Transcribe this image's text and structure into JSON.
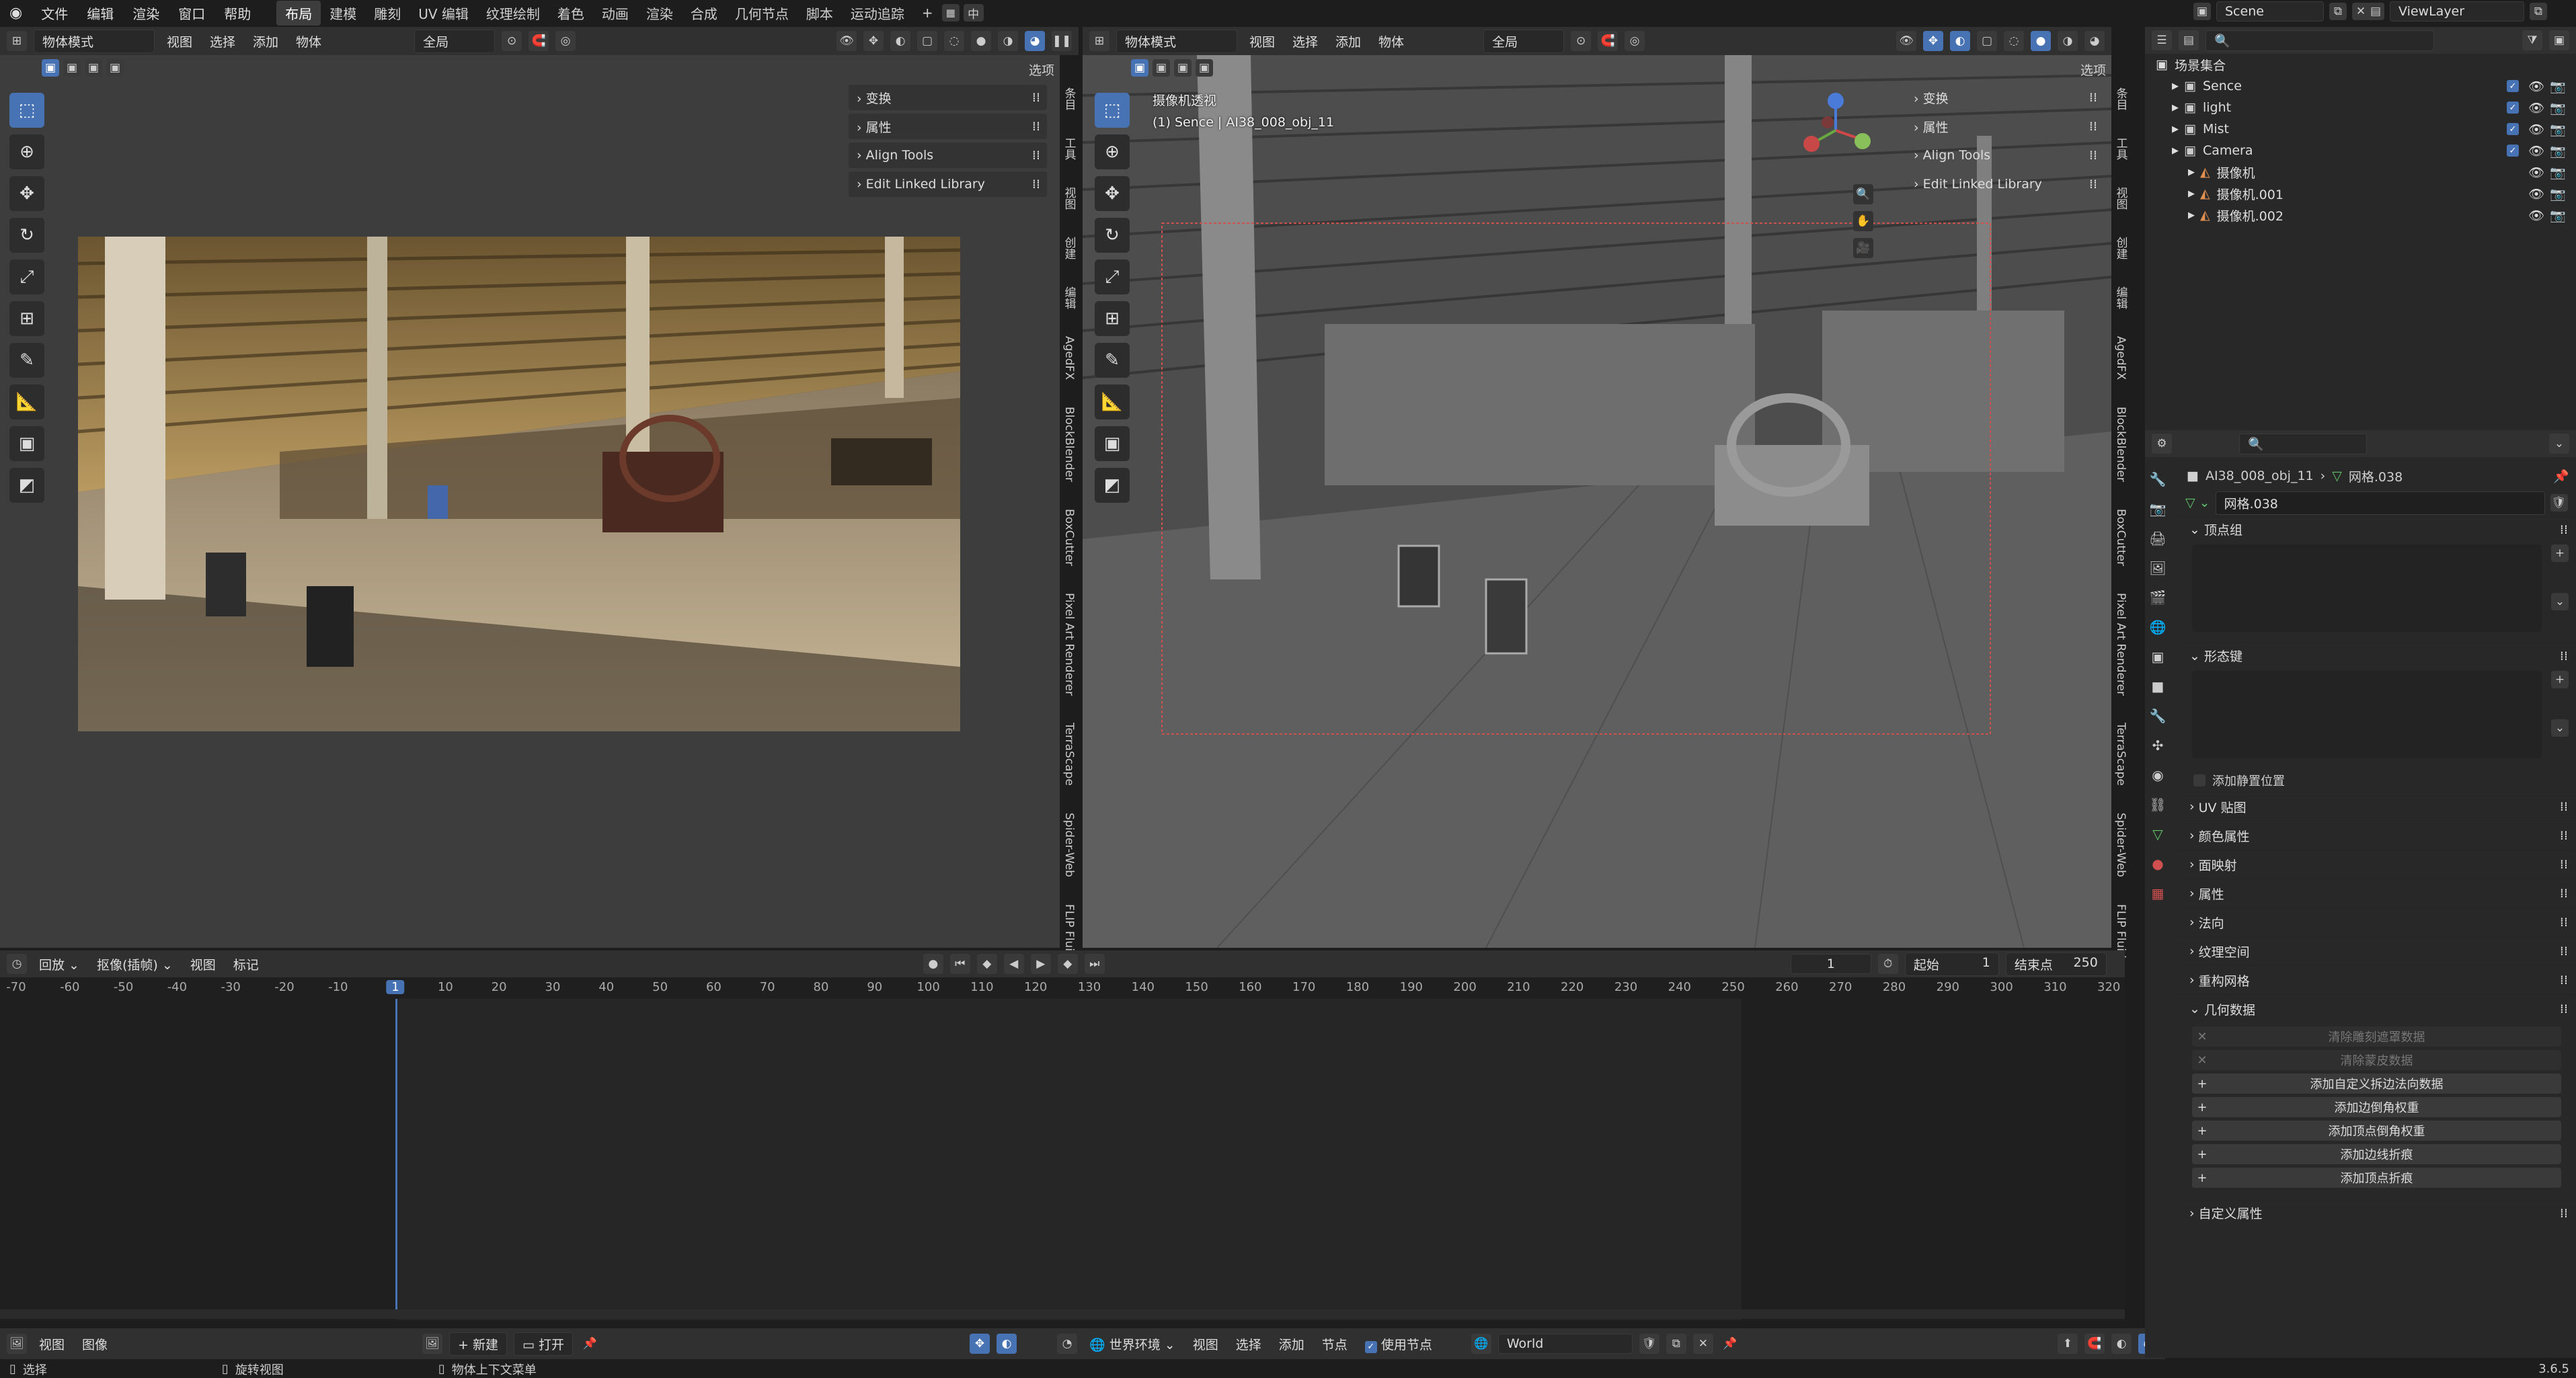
{
  "topbar": {
    "menus": [
      "文件",
      "编辑",
      "渲染",
      "窗口",
      "帮助"
    ],
    "workspace_tabs": [
      "布局",
      "建模",
      "雕刻",
      "UV 编辑",
      "纹理绘制",
      "着色",
      "动画",
      "渲染",
      "合成",
      "几何节点",
      "脚本",
      "运动追踪"
    ],
    "active_tab": "布局",
    "ime_label": "中",
    "scene_name": "Scene",
    "view_layer_name": "ViewLayer"
  },
  "left_viewport": {
    "mode": "物体模式",
    "menus": [
      "视图",
      "选择",
      "添加",
      "物体"
    ],
    "transform_orientation": "全局",
    "options_label": "选项",
    "npanel": [
      "变换",
      "属性",
      "Align Tools",
      "Edit Linked Library"
    ]
  },
  "right_viewport": {
    "mode": "物体模式",
    "menus": [
      "视图",
      "选择",
      "添加",
      "物体"
    ],
    "transform_orientation": "全局",
    "options_label": "选项",
    "camera_title": "摄像机透视",
    "camera_subtitle": "(1) Sence | AI38_008_obj_11",
    "npanel": [
      "变换",
      "属性",
      "Align Tools",
      "Edit Linked Library"
    ]
  },
  "sidebar_tabs": [
    "条目",
    "工具",
    "视图",
    "创建",
    "编辑",
    "AgedFX",
    "BlockBlender",
    "BoxCutter",
    "Pixel Art Renderer",
    "TerraScape",
    "Spider-Web",
    "FLIP Fluids"
  ],
  "timeline": {
    "playback": "回放",
    "keying": "抠像(插帧)",
    "view": "视图",
    "marker": "标记",
    "current_frame": "1",
    "start_label": "起始",
    "start_value": "1",
    "end_label": "结束点",
    "end_value": "250",
    "ticks": [
      "-70",
      "-60",
      "-50",
      "-40",
      "-30",
      "-20",
      "-10",
      "1",
      "10",
      "20",
      "30",
      "40",
      "50",
      "60",
      "70",
      "80",
      "90",
      "100",
      "110",
      "120",
      "130",
      "140",
      "150",
      "160",
      "170",
      "180",
      "190",
      "200",
      "210",
      "220",
      "230",
      "240",
      "250",
      "260",
      "270",
      "280",
      "290",
      "300",
      "310",
      "320"
    ]
  },
  "bottom_bar": {
    "view": "视图",
    "image": "图像",
    "new": "新建",
    "open": "打开",
    "world_env": "世界环境",
    "menus": [
      "视图",
      "选择",
      "添加",
      "节点"
    ],
    "use_nodes": "使用节点",
    "world_name": "World"
  },
  "status_bar": {
    "select": "选择",
    "rotate": "旋转视图",
    "context": "物体上下文菜单",
    "version": "3.6.5"
  },
  "outliner": {
    "root": "场景集合",
    "items": [
      {
        "name": "Sence",
        "indent": 0
      },
      {
        "name": "light",
        "indent": 0
      },
      {
        "name": "Mist",
        "indent": 0
      },
      {
        "name": "Camera",
        "indent": 0
      },
      {
        "name": "摄像机",
        "indent": 1
      },
      {
        "name": "摄像机.001",
        "indent": 1
      },
      {
        "name": "摄像机.002",
        "indent": 1
      }
    ]
  },
  "properties": {
    "object_name": "AI38_008_obj_11",
    "mesh_name": "网格.038",
    "data_field": "网格.038",
    "vertex_groups": "顶点组",
    "shape_keys": "形态键",
    "add_rest_position": "添加静置位置",
    "sections": [
      "UV 贴图",
      "颜色属性",
      "面映射",
      "属性",
      "法向",
      "纹理空间",
      "重构网格",
      "几何数据"
    ],
    "geometry_buttons": [
      {
        "label": "清除雕刻遮罩数据",
        "disabled": true
      },
      {
        "label": "清除蒙皮数据",
        "disabled": true
      },
      {
        "label": "添加自定义拆边法向数据",
        "disabled": false
      },
      {
        "label": "添加边倒角权重",
        "disabled": false
      },
      {
        "label": "添加顶点倒角权重",
        "disabled": false
      },
      {
        "label": "添加边线折痕",
        "disabled": false
      },
      {
        "label": "添加顶点折痕",
        "disabled": false
      }
    ],
    "custom_props": "自定义属性"
  }
}
